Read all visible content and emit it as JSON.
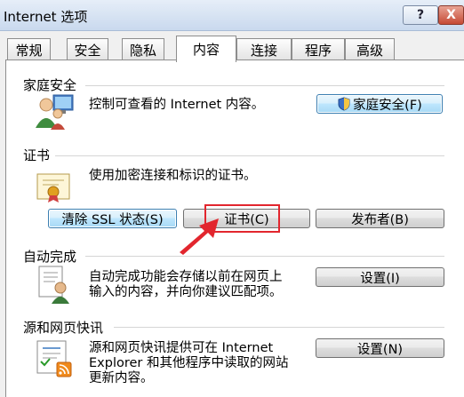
{
  "window": {
    "title": "Internet 选项",
    "help_label": "?",
    "close_label": "X"
  },
  "tabs": [
    {
      "label": "常规"
    },
    {
      "label": "安全"
    },
    {
      "label": "隐私"
    },
    {
      "label": "内容",
      "active": true
    },
    {
      "label": "连接"
    },
    {
      "label": "程序"
    },
    {
      "label": "高级"
    }
  ],
  "family_safety": {
    "title": "家庭安全",
    "description": "控制可查看的 Internet 内容。",
    "button_label": "家庭安全(F)",
    "icon": "family-safety-icon"
  },
  "certificates": {
    "title": "证书",
    "description": "使用加密连接和标识的证书。",
    "clear_ssl_label": "清除 SSL 状态(S)",
    "certificates_label": "证书(C)",
    "publishers_label": "发布者(B)",
    "icon": "certificate-icon"
  },
  "autocomplete": {
    "title": "自动完成",
    "description_line1": "自动完成功能会存储以前在网页上",
    "description_line2": "输入的内容，并向你建议匹配项。",
    "settings_label": "设置(I)",
    "icon": "autocomplete-icon"
  },
  "feeds": {
    "title": "源和网页快讯",
    "description_line1": "源和网页快讯提供可在 Internet",
    "description_line2": "Explorer 和其他程序中读取的网站",
    "description_line3": "更新内容。",
    "settings_label": "设置(N)",
    "icon": "feeds-icon"
  },
  "annotation": {
    "highlight_color": "#e2262e",
    "arrow_color": "#e2262e"
  }
}
